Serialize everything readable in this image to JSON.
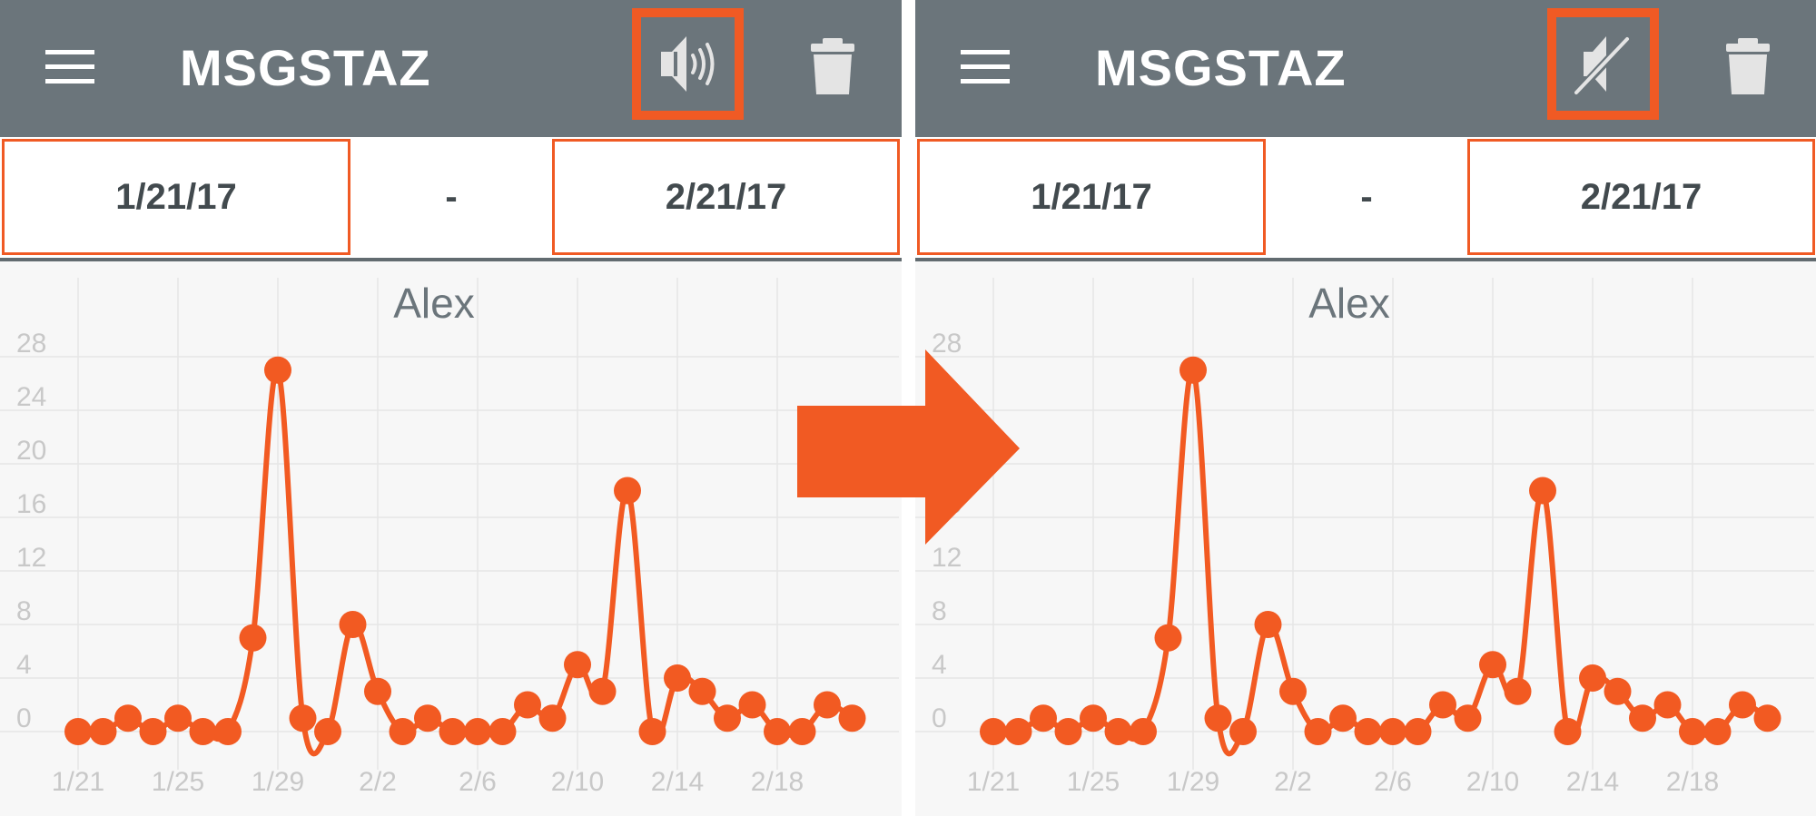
{
  "panels": [
    {
      "app_title": "MSGSTAZ",
      "sound_state": "sound-on",
      "date_range": {
        "start": "1/21/17",
        "separator": "-",
        "end": "2/21/17"
      },
      "chart_title": "Alex"
    },
    {
      "app_title": "MSGSTAZ",
      "sound_state": "sound-muted",
      "date_range": {
        "start": "1/21/17",
        "separator": "-",
        "end": "2/21/17"
      },
      "chart_title": "Alex"
    }
  ],
  "colors": {
    "appbar": "#6b757b",
    "accent": "#f05a24",
    "line": "#f25a22",
    "grid": "#e6e6e6",
    "tick": "#c8c8c8"
  },
  "chart_data": {
    "type": "line",
    "title": "Alex",
    "x_ticks": [
      "1/21",
      "1/25",
      "1/29",
      "2/2",
      "2/6",
      "2/10",
      "2/14",
      "2/18"
    ],
    "y_ticks": [
      0,
      4,
      8,
      12,
      16,
      20,
      24,
      28
    ],
    "ylim": [
      0,
      28
    ],
    "grid": true,
    "series": [
      {
        "x": [
          "1/21",
          "1/22",
          "1/23",
          "1/24",
          "1/25",
          "1/26",
          "1/27",
          "1/28",
          "1/29",
          "1/30",
          "1/31",
          "2/1",
          "2/2",
          "2/3",
          "2/4",
          "2/5",
          "2/6",
          "2/7",
          "2/8",
          "2/9",
          "2/10",
          "2/11",
          "2/12",
          "2/13",
          "2/14",
          "2/15",
          "2/16",
          "2/17",
          "2/18",
          "2/19",
          "2/20",
          "2/21"
        ],
        "values": [
          0,
          0,
          1,
          0,
          1,
          0,
          0,
          7,
          27,
          1,
          0,
          8,
          3,
          0,
          1,
          0,
          0,
          0,
          2,
          1,
          5,
          3,
          18,
          0,
          4,
          3,
          1,
          2,
          0,
          0,
          2,
          1
        ]
      }
    ]
  },
  "arrow_icon": "right-arrow"
}
